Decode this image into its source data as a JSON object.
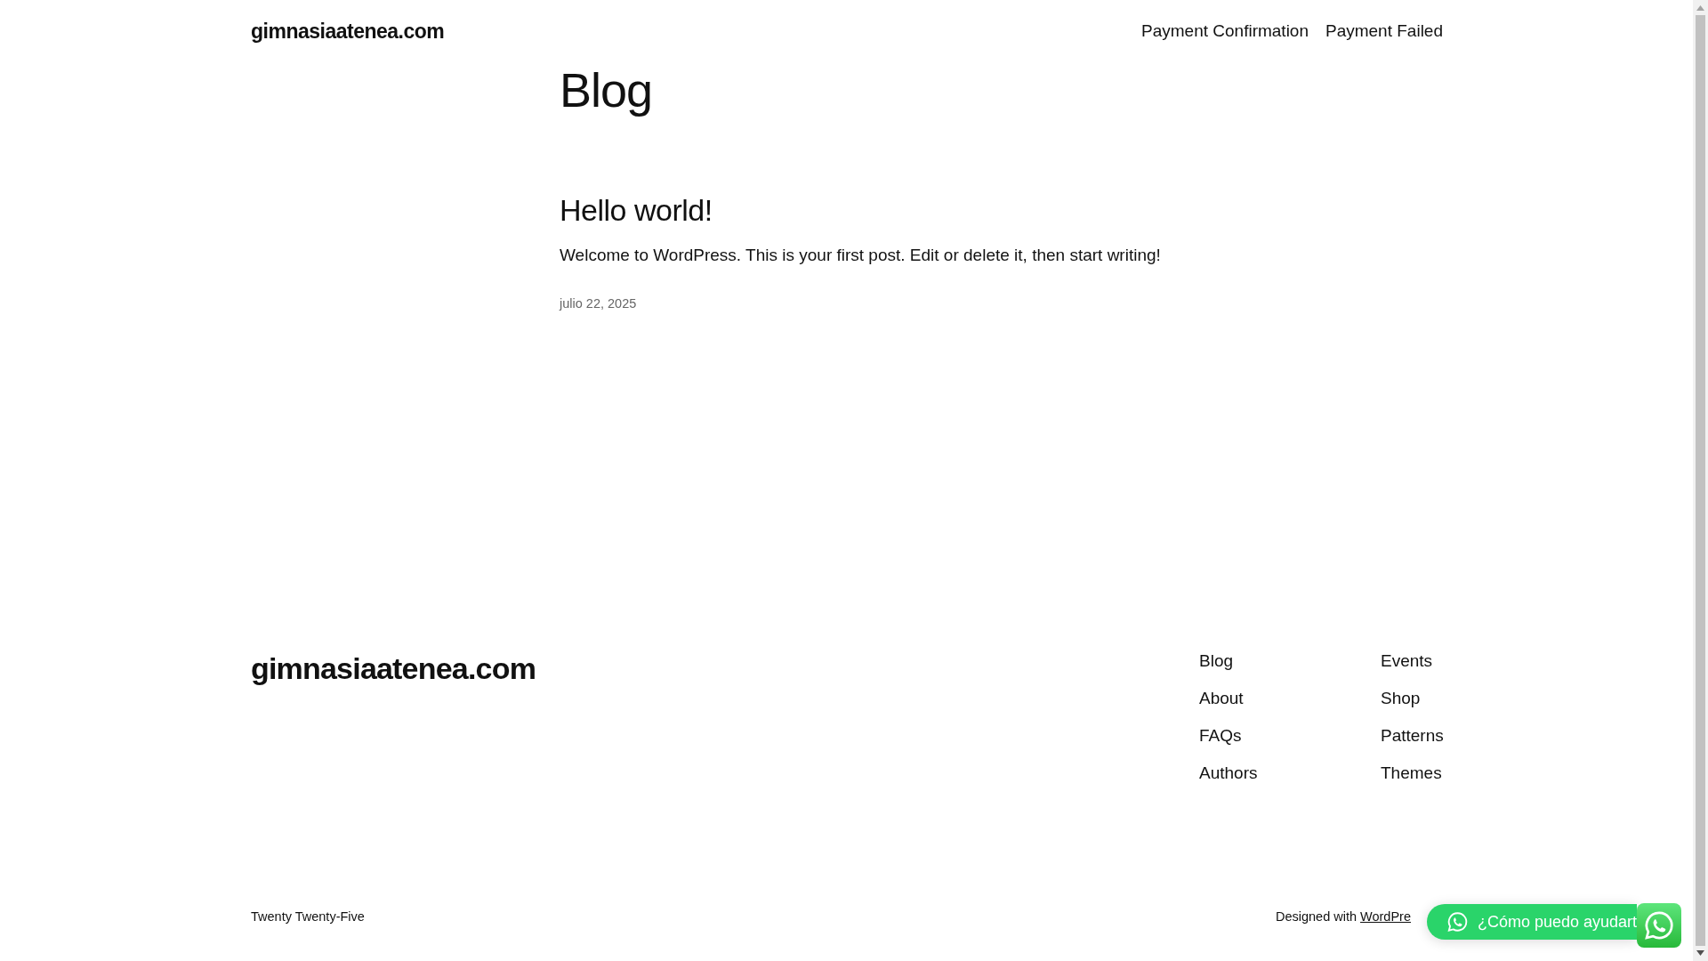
{
  "header": {
    "site_title": "gimnasiaatenea.com",
    "nav": [
      {
        "label": "Payment Confirmation"
      },
      {
        "label": "Payment Failed"
      }
    ]
  },
  "main": {
    "title": "Blog",
    "posts": [
      {
        "title": "Hello world!",
        "excerpt": "Welcome to WordPress. This is your first post. Edit or delete it, then start writing!",
        "date": "julio 22, 2025"
      }
    ]
  },
  "footer": {
    "site_title": "gimnasiaatenea.com",
    "nav_columns": [
      [
        "Blog",
        "About",
        "FAQs",
        "Authors"
      ],
      [
        "Events",
        "Shop",
        "Patterns",
        "Themes"
      ]
    ],
    "theme_name": "Twenty Twenty-Five",
    "credit": {
      "text": "Designed with",
      "link": "WordPre"
    }
  },
  "chat_widget": {
    "label": "¿Cómo puedo ayudart"
  }
}
